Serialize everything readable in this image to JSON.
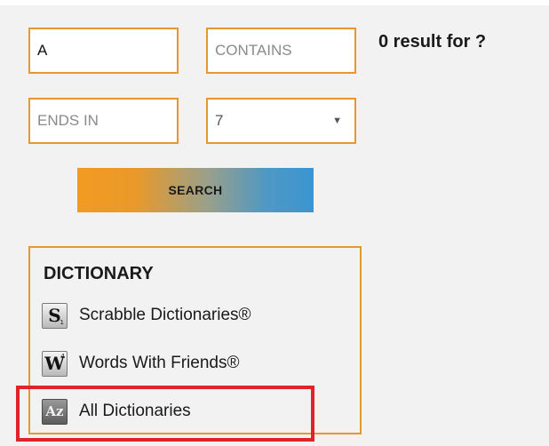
{
  "search_form": {
    "pattern_value": "A",
    "contains_placeholder": "CONTAINS",
    "ends_in_placeholder": "ENDS IN",
    "length_selected": "7",
    "search_label": "SEARCH",
    "result_text": "0 result for ?"
  },
  "dictionary": {
    "title": "DICTIONARY",
    "items": [
      {
        "label": "Scrabble Dictionaries®",
        "icon": "scrabble-tile-icon",
        "icon_letter": "S",
        "icon_sub": "1"
      },
      {
        "label": "Words With Friends®",
        "icon": "words-with-friends-tile-icon",
        "icon_letter": "W",
        "icon_sub": "4"
      },
      {
        "label": "All Dictionaries",
        "icon": "all-dictionaries-icon",
        "icon_letter": "Az",
        "icon_sub": ""
      }
    ]
  },
  "colors": {
    "field_border": "#e8962e",
    "panel_bg": "#f2f2f2",
    "highlight_border": "#e2222b"
  }
}
